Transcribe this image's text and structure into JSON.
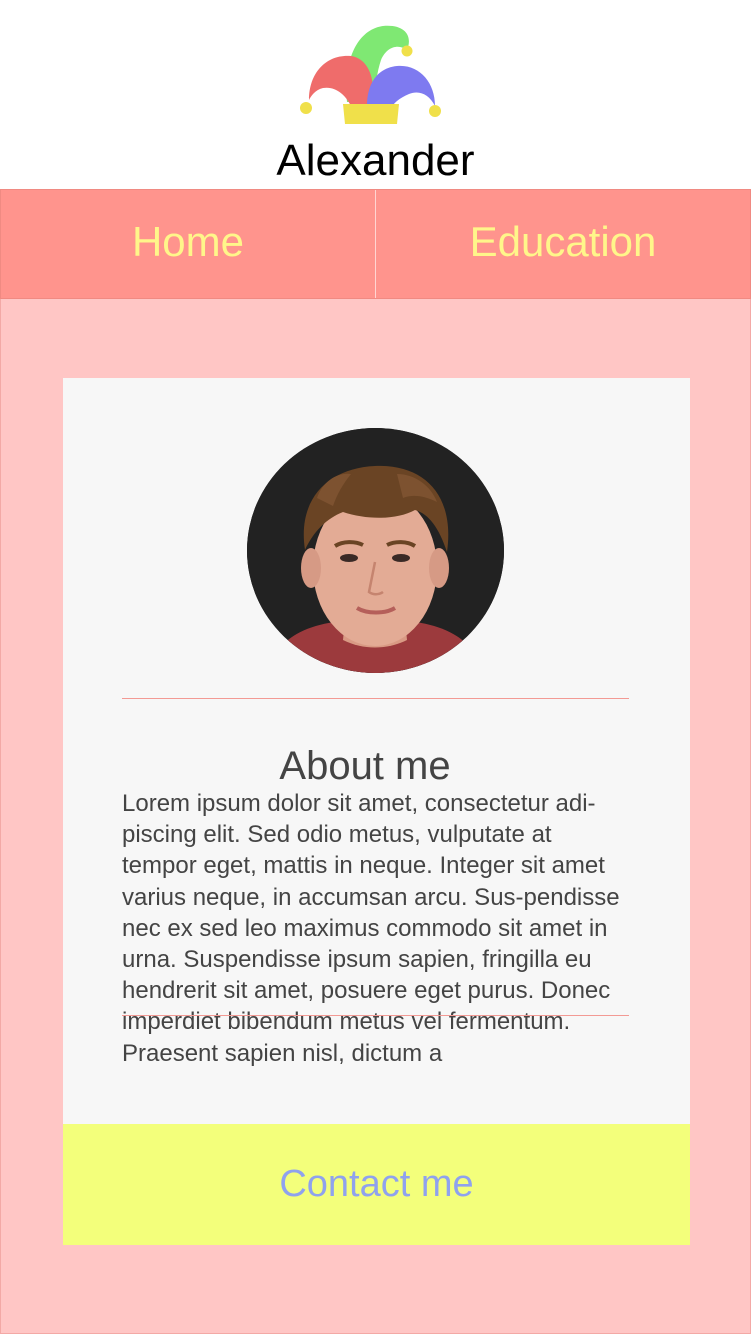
{
  "header": {
    "site_name": "Alexander",
    "logo_icon": "jester-hat-icon"
  },
  "nav": {
    "items": [
      {
        "label": "Home"
      },
      {
        "label": "Education"
      }
    ]
  },
  "card": {
    "avatar_icon": "profile-photo",
    "about_title": "About me",
    "about_text": "Lorem ipsum dolor sit amet, consectetur adi-piscing elit. Sed odio metus, vulputate at tempor eget, mattis in neque. Integer sit amet varius neque, in accumsan arcu. Sus-pendisse nec ex sed leo maximus commodo sit amet in urna. Suspendisse ipsum sapien, fringilla eu hendrerit sit amet, posuere eget purus. Donec imperdiet bibendum metus vel fermentum. Praesent sapien nisl, dictum a",
    "contact_label": "Contact me"
  },
  "colors": {
    "nav_background": "#ff948d",
    "nav_text": "#fff68a",
    "page_background": "#ffc6c5",
    "card_background": "#f7f7f7",
    "button_background": "#f3ff7b",
    "button_text": "#8fa2ee",
    "divider": "#f39a94"
  }
}
